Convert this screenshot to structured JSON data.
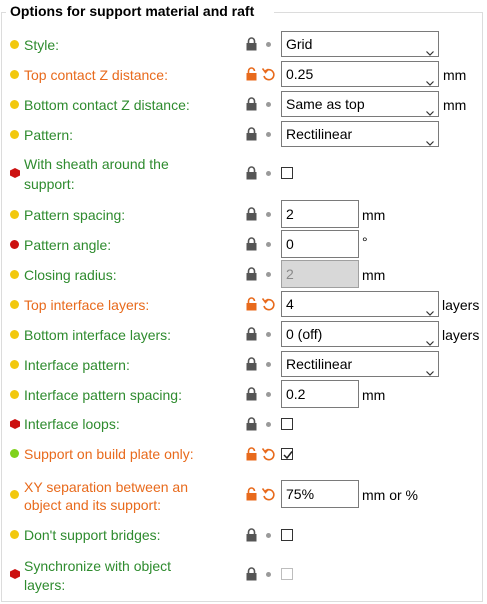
{
  "group": {
    "title": "Options for support material and raft"
  },
  "rows": [
    {
      "label": "Style:",
      "value": "Grid"
    },
    {
      "label": "Top contact Z distance:",
      "value": "0.25",
      "unit": "mm"
    },
    {
      "label": "Bottom contact Z distance:",
      "value": "Same as top",
      "unit": "mm"
    },
    {
      "label": "Pattern:",
      "value": "Rectilinear"
    },
    {
      "label": "With sheath around the",
      "label2": "support:"
    },
    {
      "label": "Pattern spacing:",
      "value": "2",
      "unit": "mm"
    },
    {
      "label": "Pattern angle:",
      "value": "0",
      "unit": "°"
    },
    {
      "label": "Closing radius:",
      "value": "2",
      "unit": "mm"
    },
    {
      "label": "Top interface layers:",
      "value": "4",
      "unit": "layers"
    },
    {
      "label": "Bottom interface layers:",
      "value": "0 (off)",
      "unit": "layers"
    },
    {
      "label": "Interface pattern:",
      "value": "Rectilinear"
    },
    {
      "label": "Interface pattern spacing:",
      "value": "0.2",
      "unit": "mm"
    },
    {
      "label": "Interface loops:"
    },
    {
      "label": "Support on build plate only:"
    },
    {
      "label": "XY separation between an",
      "label2": "object and its support:",
      "value": "75%",
      "unit": "mm or %"
    },
    {
      "label": "Don't support bridges:"
    },
    {
      "label": "Synchronize with object",
      "label2": "layers:"
    }
  ],
  "colors": {
    "label_default": "#2e8b2e",
    "label_modified": "#e86a1c",
    "dot_simple": "#f2c80f",
    "dot_advanced": "#cc1111",
    "dot_expert": "#7fd11c"
  },
  "icons": {
    "lock": "lock-icon",
    "unlock": "unlock-icon",
    "undo": "undo-arrow-icon",
    "caret": "chevron-down-icon",
    "check": "checkmark-icon"
  }
}
